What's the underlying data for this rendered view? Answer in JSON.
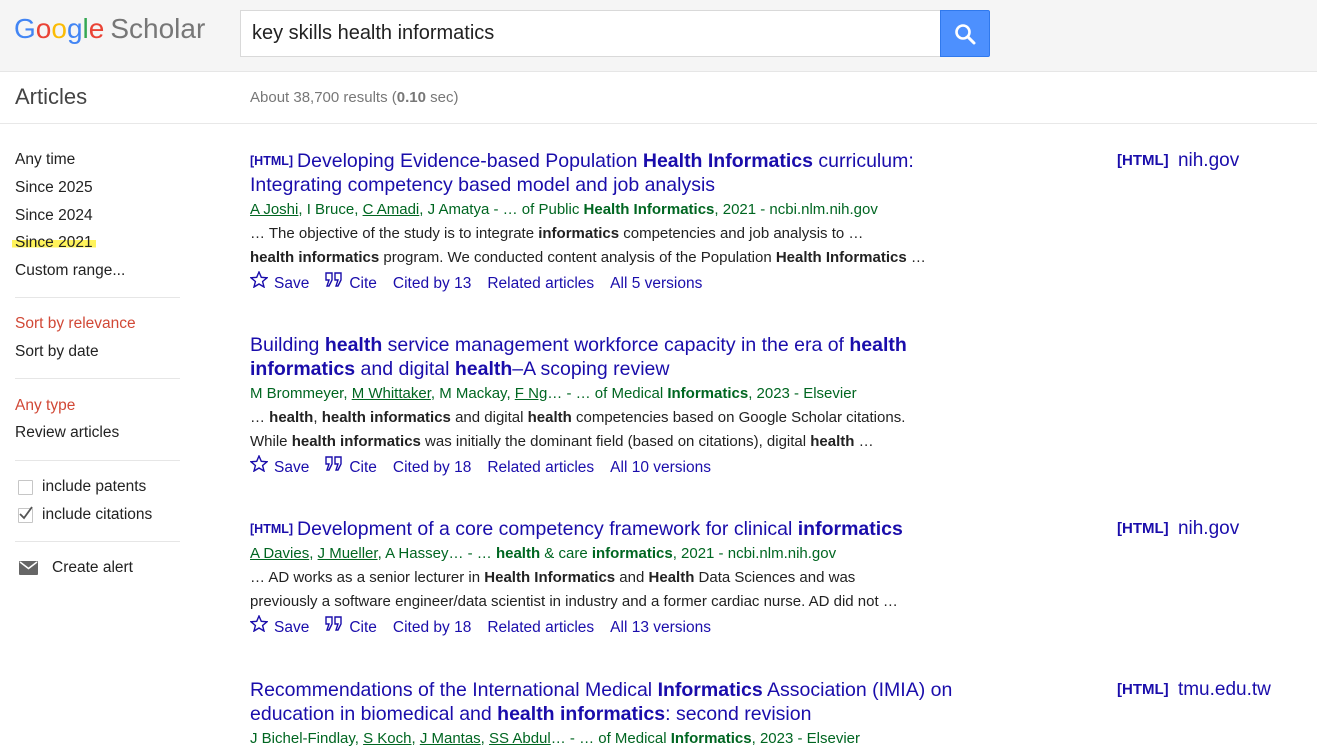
{
  "header": {
    "logo_letters": [
      "G",
      "o",
      "o",
      "g",
      "l",
      "e"
    ],
    "logo_suffix": "Scholar",
    "search_query": "key skills health informatics"
  },
  "subheader": {
    "section_label": "Articles",
    "results_prefix": "About 38,700 results (",
    "results_time": "0.10",
    "results_suffix": " sec)"
  },
  "sidebar": {
    "time_filters": [
      "Any time",
      "Since 2025",
      "Since 2024",
      "Since 2021",
      "Custom range..."
    ],
    "sort_options": [
      "Sort by relevance",
      "Sort by date"
    ],
    "type_options": [
      "Any type",
      "Review articles"
    ],
    "include_patents": "include patents",
    "include_citations": "include citations",
    "create_alert": "Create alert"
  },
  "results": [
    {
      "tag": "[HTML]",
      "title_html": "Developing Evidence-based Population <b>Health Informatics</b> curriculum: Integrating competency based model and job analysis",
      "authors_html": "<u>A Joshi</u>, I Bruce, <u>C Amadi</u>, J Amatya - … of Public <b>Health Informatics</b>, 2021 - ncbi.nlm.nih.gov",
      "snippet1_html": "… The objective of the study is to integrate <b>informatics</b> competencies and job analysis to …",
      "snippet2_html": "<b>health informatics</b> program. We conducted content analysis of the Population <b>Health Informatics</b> …",
      "save": "Save",
      "cite": "Cite",
      "cited_by": "Cited by 13",
      "related": "Related articles",
      "versions": "All 5 versions",
      "side_tag": "[HTML]",
      "side_domain": "nih.gov"
    },
    {
      "tag": "",
      "title_html": "Building <b>health</b> service management workforce capacity in the era of <b>health informatics</b> and digital <b>health</b>–A scoping review",
      "authors_html": "M Brommeyer, <u>M Whittaker</u>, M Mackay, <u>F Ng</u>… - … of Medical <b>Informatics</b>, 2023 - Elsevier",
      "snippet1_html": "… <b>health</b>, <b>health informatics</b> and digital <b>health</b> competencies based on Google Scholar citations.",
      "snippet2_html": "While <b>health informatics</b> was initially the dominant field (based on citations), digital <b>health</b> …",
      "save": "Save",
      "cite": "Cite",
      "cited_by": "Cited by 18",
      "related": "Related articles",
      "versions": "All 10 versions",
      "side_tag": "",
      "side_domain": ""
    },
    {
      "tag": "[HTML]",
      "title_html": "Development of a core competency framework for clinical <b>informatics</b>",
      "authors_html": "<u>A Davies</u>, <u>J Mueller</u>, A Hassey… - … <b>health</b> &amp; care <b>informatics</b>, 2021 - ncbi.nlm.nih.gov",
      "snippet1_html": "… AD works as a senior lecturer in <b>Health Informatics</b> and <b>Health</b> Data Sciences and was",
      "snippet2_html": "previously a software engineer/data scientist in industry and a former cardiac nurse. AD did not …",
      "save": "Save",
      "cite": "Cite",
      "cited_by": "Cited by 18",
      "related": "Related articles",
      "versions": "All 13 versions",
      "side_tag": "[HTML]",
      "side_domain": "nih.gov"
    },
    {
      "tag": "",
      "title_html": "Recommendations of the International Medical <b>Informatics</b> Association (IMIA) on education in biomedical and <b>health informatics</b>: second revision",
      "authors_html": "J Bichel-Findlay, <u>S Koch</u>, <u>J Mantas</u>, <u>SS Abdul</u>… - … of Medical <b>Informatics</b>, 2023 - Elsevier",
      "side_tag": "[HTML]",
      "side_domain": "tmu.edu.tw"
    }
  ]
}
